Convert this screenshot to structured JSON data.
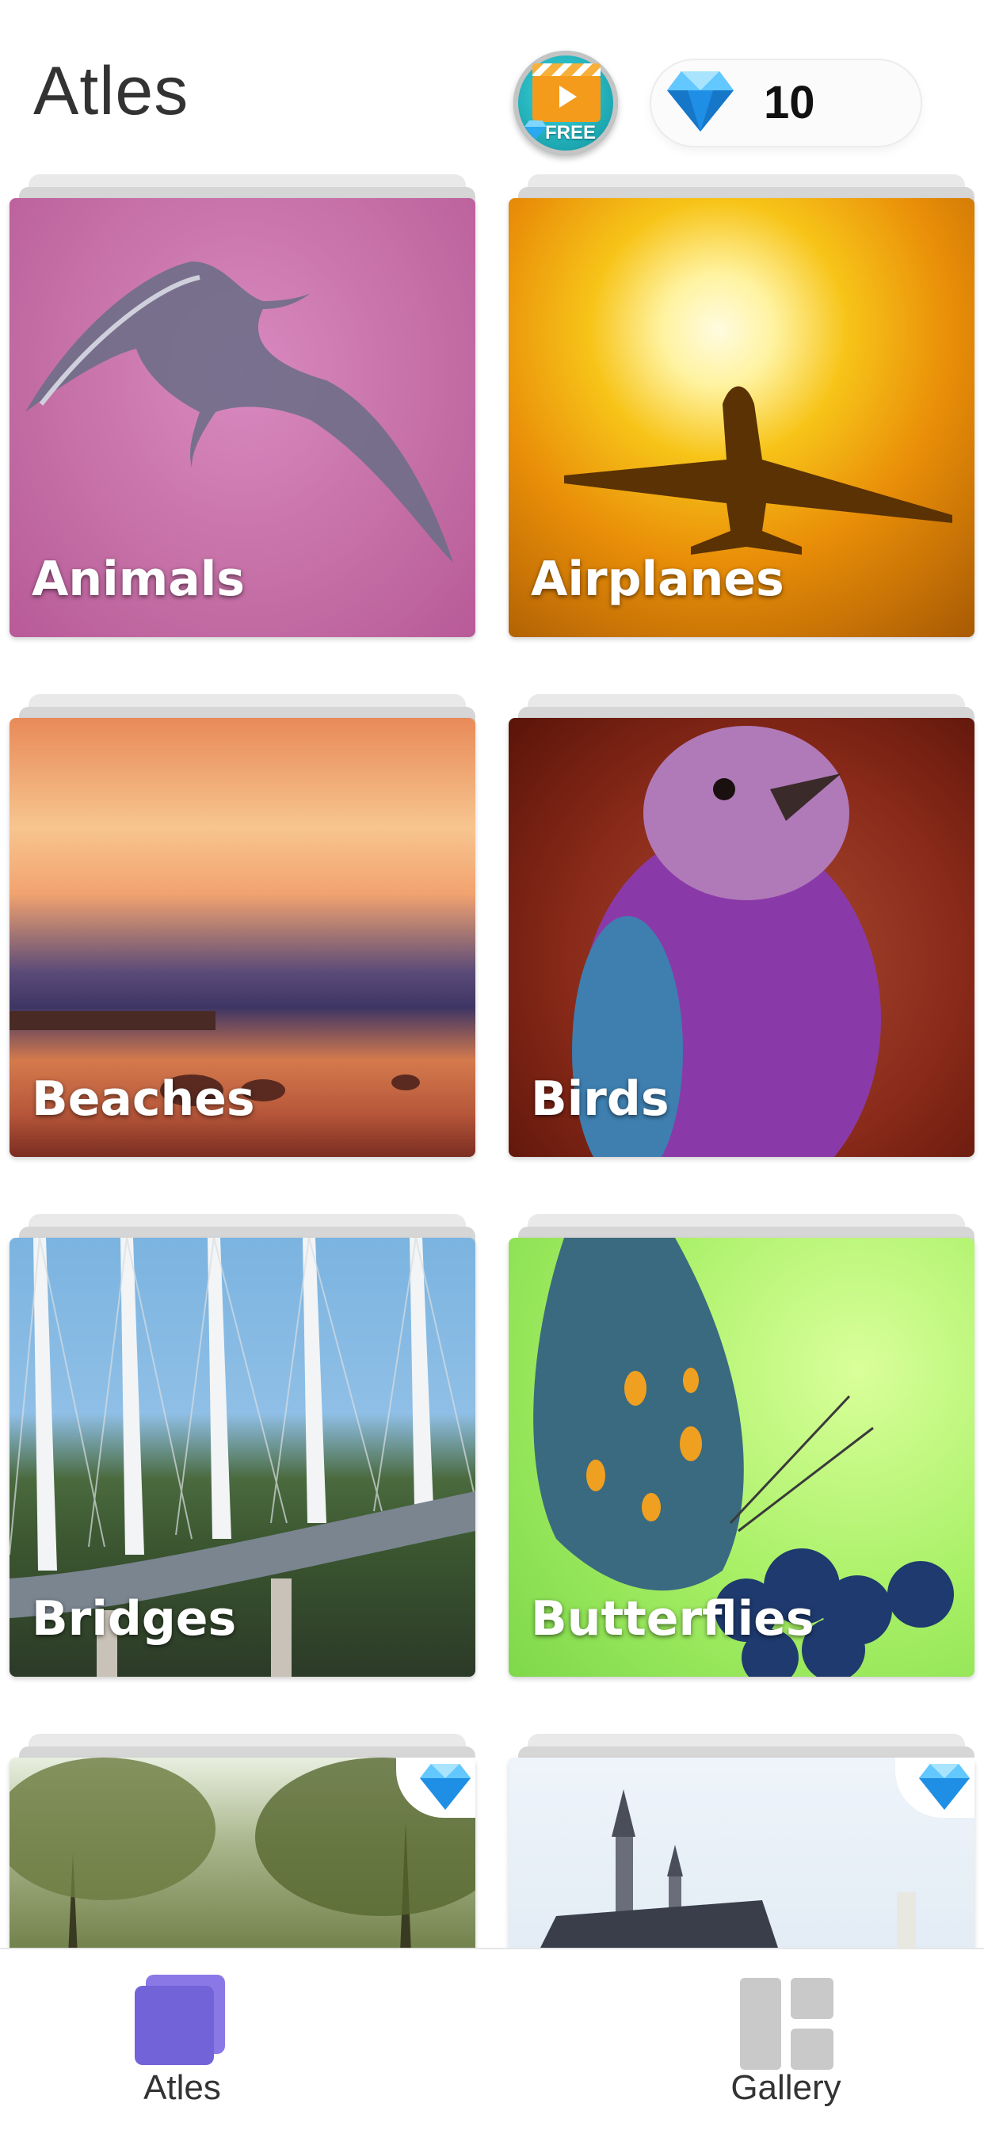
{
  "header": {
    "title": "Atles",
    "free_button_label": "FREE",
    "gem_count": "10"
  },
  "categories": [
    {
      "label": "Animals",
      "locked": false
    },
    {
      "label": "Airplanes",
      "locked": false
    },
    {
      "label": "Beaches",
      "locked": false
    },
    {
      "label": "Birds",
      "locked": false
    },
    {
      "label": "Bridges",
      "locked": false
    },
    {
      "label": "Butterflies",
      "locked": false
    },
    {
      "label": "",
      "locked": true
    },
    {
      "label": "",
      "locked": true
    }
  ],
  "bottom_nav": {
    "items": [
      {
        "label": "Atles",
        "icon": "stacked-squares-icon",
        "active": true
      },
      {
        "label": "Gallery",
        "icon": "gallery-grid-icon",
        "active": false
      }
    ]
  },
  "colors": {
    "accent": "#7263d8",
    "inactive_icon": "#c9c9c9",
    "gem_blue": "#2aa9f0"
  }
}
